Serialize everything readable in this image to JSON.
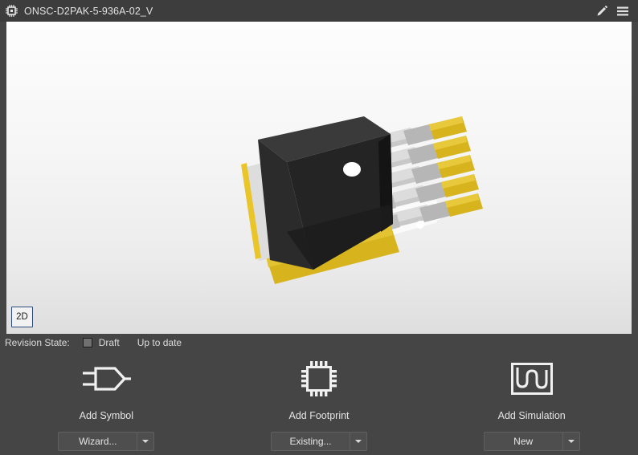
{
  "titlebar": {
    "icon": "chip-icon",
    "title": "ONSC-D2PAK-5-936A-02_V",
    "edit_icon": "pencil-icon",
    "menu_icon": "hamburger-menu-icon"
  },
  "viewport": {
    "view_toggle_label": "2D",
    "model_name": "D2PAK-5 package 3D preview",
    "colors": {
      "body": "#262626",
      "body_side": "#1a1a1a",
      "tab_metal": "#c9c9c9",
      "lead_metal": "#b9b9b9",
      "lead_gold": "#d6b520",
      "background_top": "#fdfdfd",
      "background_bottom": "#dedede"
    }
  },
  "revision": {
    "label": "Revision State:",
    "swatch_color": "#707070",
    "state": "Draft",
    "status": "Up to date"
  },
  "actions": [
    {
      "icon": "symbol-gate-icon",
      "label": "Add Symbol",
      "button_label": "Wizard...",
      "dropdown_icon": "chevron-down-icon"
    },
    {
      "icon": "footprint-chip-icon",
      "label": "Add Footprint",
      "button_label": "Existing...",
      "dropdown_icon": "chevron-down-icon"
    },
    {
      "icon": "simulation-waveform-icon",
      "label": "Add Simulation",
      "button_label": "New",
      "dropdown_icon": "chevron-down-icon"
    }
  ],
  "theme": {
    "window_background": "#454545",
    "titlebar_background": "#3d3d3d",
    "accent_border": "#2e4a7d",
    "text": "#e2e2e2"
  }
}
